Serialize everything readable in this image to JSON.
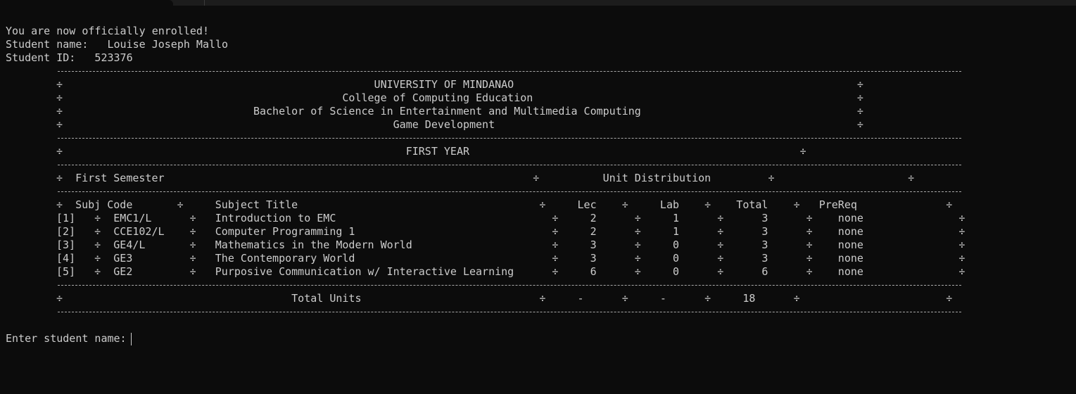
{
  "terminal": {
    "lines": {
      "enrolled_msg": "You are now officially enrolled!",
      "student_name": "Student name:   Louise Joseph Mallo",
      "student_id": "Student ID:   523376",
      "uni_row": "÷                                                 UNIVERSITY OF MINDANAO                                                      ÷",
      "college_row": "÷                                            College of Computing Education                                                   ÷",
      "program_row": "÷                              Bachelor of Science in Entertainment and Multimedia Computing                                  ÷",
      "major_row": "÷                                                    Game Development                                                         ÷",
      "year_row": "÷                                                      FIRST YEAR                                                    ÷",
      "semester_row": "÷  First Semester                                                          ÷          Unit Distribution         ÷                     ÷",
      "header_row": "÷  Subj Code       ÷     Subject Title                                      ÷     Lec    ÷     Lab    ÷    Total    ÷   PreReq              ÷",
      "course_1": "[1]   ÷  EMC1/L      ÷   Introduction to EMC                                  ÷     2      ÷     1      ÷      3      ÷    none               ÷",
      "course_2": "[2]   ÷  CCE102/L    ÷   Computer Programming 1                               ÷     2      ÷     1      ÷      3      ÷    none               ÷",
      "course_3": "[3]   ÷  GE4/L       ÷   Mathematics in the Modern World                      ÷     3      ÷     0      ÷      3      ÷    none               ÷",
      "course_4": "[4]   ÷  GE3         ÷   The Contemporary World                               ÷     3      ÷     0      ÷      3      ÷    none               ÷",
      "course_5": "[5]   ÷  GE2         ÷   Purposive Communication w/ Interactive Learning      ÷     6      ÷     0      ÷      6      ÷    none               ÷",
      "total_row": "÷                                    Total Units                            ÷     -      ÷     -      ÷     18      ÷                       ÷",
      "prompt": "Enter student name:"
    }
  }
}
